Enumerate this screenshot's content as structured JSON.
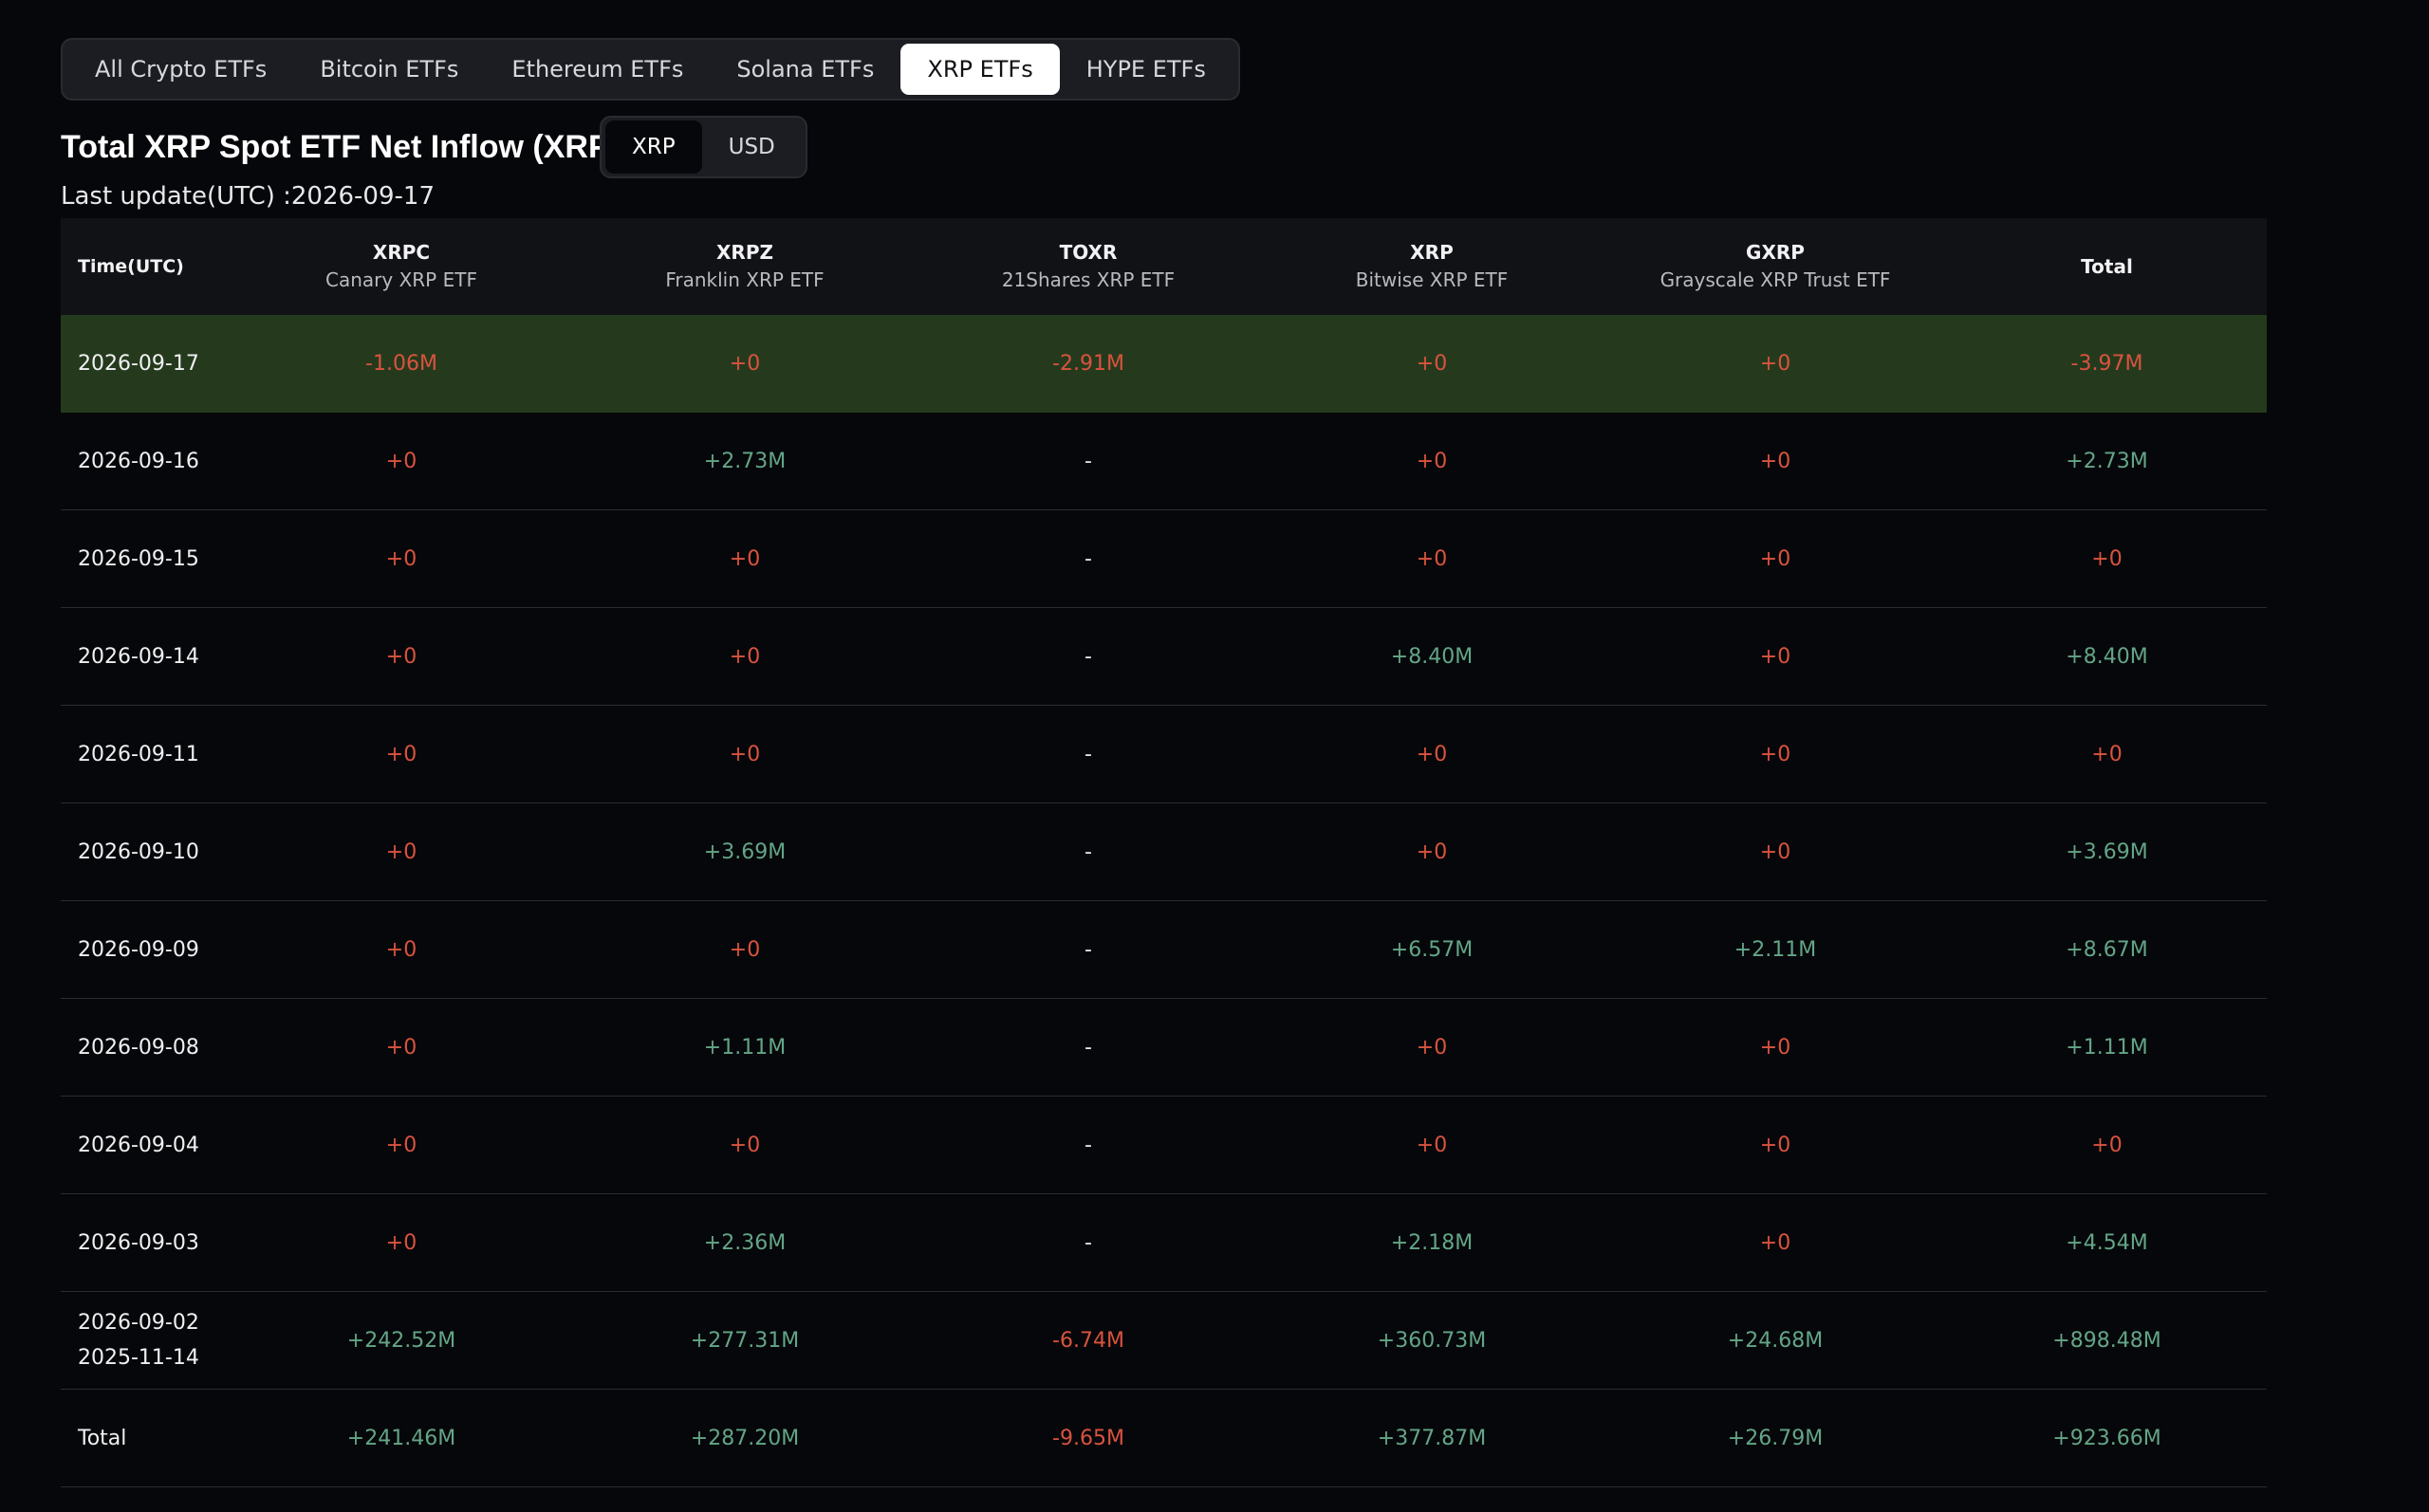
{
  "tabs": [
    {
      "label": "All Crypto ETFs",
      "active": false
    },
    {
      "label": "Bitcoin ETFs",
      "active": false
    },
    {
      "label": "Ethereum ETFs",
      "active": false
    },
    {
      "label": "Solana ETFs",
      "active": false
    },
    {
      "label": "XRP ETFs",
      "active": true
    },
    {
      "label": "HYPE ETFs",
      "active": false
    }
  ],
  "title": "Total XRP Spot ETF Net Inflow (XRP)",
  "unit_toggle": {
    "options": [
      "XRP",
      "USD"
    ],
    "selected": "XRP"
  },
  "last_update": "Last update(UTC) :2026-09-17",
  "table": {
    "time_header": "Time(UTC)",
    "total_header": "Total",
    "etfs": [
      {
        "ticker": "XRPC",
        "name": "Canary XRP ETF"
      },
      {
        "ticker": "XRPZ",
        "name": "Franklin XRP ETF"
      },
      {
        "ticker": "TOXR",
        "name": "21Shares XRP ETF"
      },
      {
        "ticker": "XRP",
        "name": "Bitwise XRP ETF"
      },
      {
        "ticker": "GXRP",
        "name": "Grayscale XRP Trust ETF"
      }
    ],
    "rows": [
      {
        "date": [
          "2026-09-17"
        ],
        "values": [
          "-1.06M",
          "+0",
          "-2.91M",
          "+0",
          "+0"
        ],
        "total": "-3.97M",
        "highlight": true
      },
      {
        "date": [
          "2026-09-16"
        ],
        "values": [
          "+0",
          "+2.73M",
          "-",
          "+0",
          "+0"
        ],
        "total": "+2.73M"
      },
      {
        "date": [
          "2026-09-15"
        ],
        "values": [
          "+0",
          "+0",
          "-",
          "+0",
          "+0"
        ],
        "total": "+0"
      },
      {
        "date": [
          "2026-09-14"
        ],
        "values": [
          "+0",
          "+0",
          "-",
          "+8.40M",
          "+0"
        ],
        "total": "+8.40M"
      },
      {
        "date": [
          "2026-09-11"
        ],
        "values": [
          "+0",
          "+0",
          "-",
          "+0",
          "+0"
        ],
        "total": "+0"
      },
      {
        "date": [
          "2026-09-10"
        ],
        "values": [
          "+0",
          "+3.69M",
          "-",
          "+0",
          "+0"
        ],
        "total": "+3.69M"
      },
      {
        "date": [
          "2026-09-09"
        ],
        "values": [
          "+0",
          "+0",
          "-",
          "+6.57M",
          "+2.11M"
        ],
        "total": "+8.67M"
      },
      {
        "date": [
          "2026-09-08"
        ],
        "values": [
          "+0",
          "+1.11M",
          "-",
          "+0",
          "+0"
        ],
        "total": "+1.11M"
      },
      {
        "date": [
          "2026-09-04"
        ],
        "values": [
          "+0",
          "+0",
          "-",
          "+0",
          "+0"
        ],
        "total": "+0"
      },
      {
        "date": [
          "2026-09-03"
        ],
        "values": [
          "+0",
          "+2.36M",
          "-",
          "+2.18M",
          "+0"
        ],
        "total": "+4.54M"
      },
      {
        "date": [
          "2026-09-02",
          "2025-11-14"
        ],
        "values": [
          "+242.52M",
          "+277.31M",
          "-6.74M",
          "+360.73M",
          "+24.68M"
        ],
        "total": "+898.48M"
      },
      {
        "date": [
          "Total"
        ],
        "values": [
          "+241.46M",
          "+287.20M",
          "-9.65M",
          "+377.87M",
          "+26.79M"
        ],
        "total": "+923.66M"
      }
    ]
  },
  "colors": {
    "positive": "#63a587",
    "negative_or_zero": "#d9533e",
    "highlight_row": "#253a1d",
    "background": "#06070a"
  }
}
